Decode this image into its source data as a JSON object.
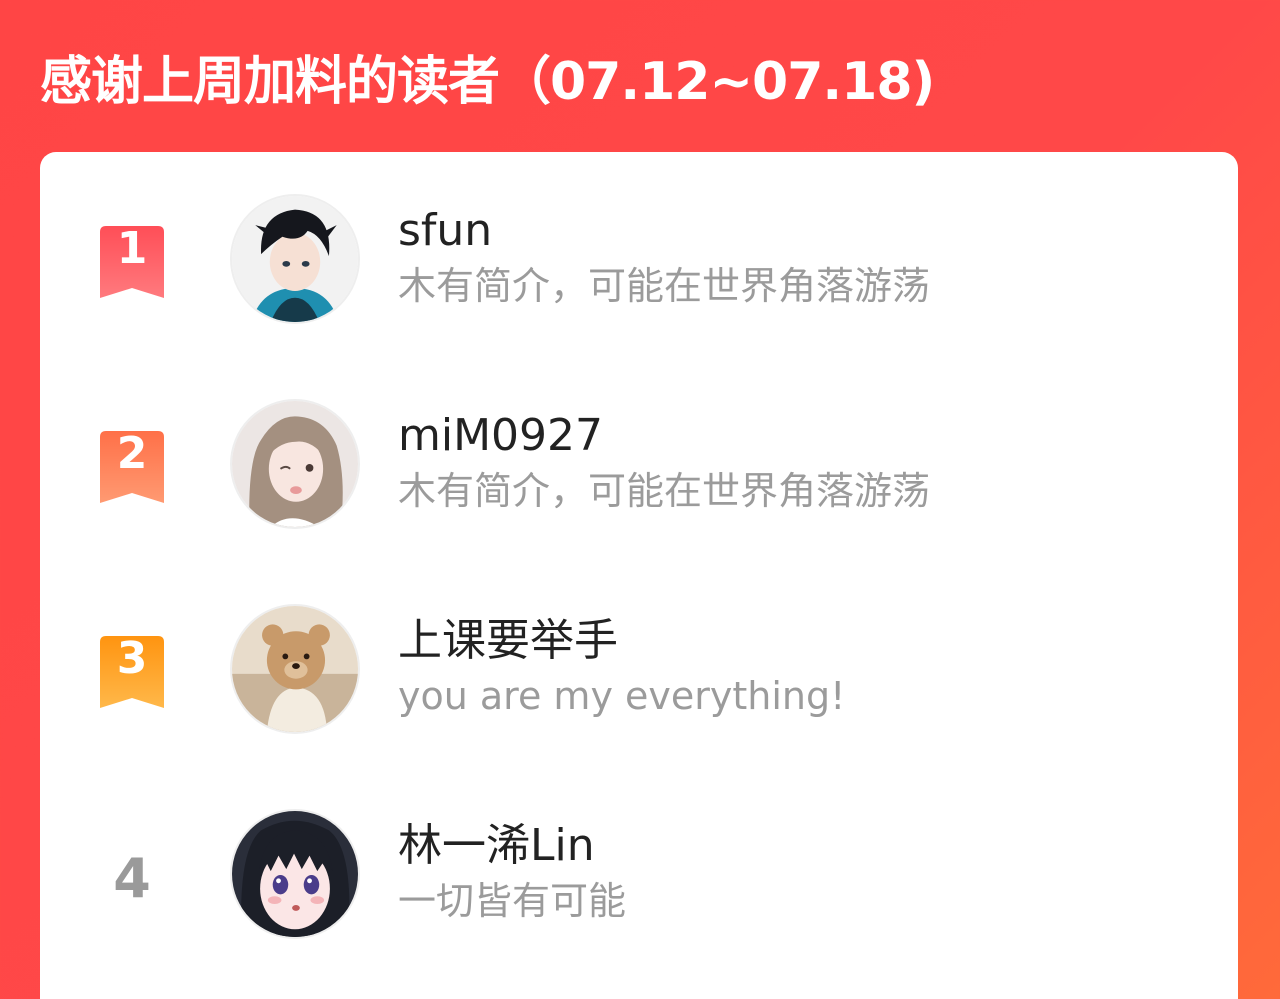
{
  "header": {
    "title": "感谢上周加料的读者（07.12~07.18)"
  },
  "colors": {
    "background": "#ff4848",
    "rank1": "#ff5a5f",
    "rank2": "#ff7b52",
    "rank3": "#ff9a1f",
    "rank_plain": "#9a9a9a",
    "name": "#222222",
    "bio": "#9b9b9b"
  },
  "readers": [
    {
      "rank": "1",
      "name": "sfun",
      "bio": "木有简介，可能在世界角落游荡",
      "avatar": "avatar-anime-boy"
    },
    {
      "rank": "2",
      "name": "miM0927",
      "bio": "木有简介，可能在世界角落游荡",
      "avatar": "avatar-girl-photo"
    },
    {
      "rank": "3",
      "name": "上课要举手",
      "bio": "you are my everything!",
      "avatar": "avatar-teddy-bear"
    },
    {
      "rank": "4",
      "name": "林一浠Lin",
      "bio": "一切皆有可能",
      "avatar": "avatar-anime-girl"
    }
  ]
}
